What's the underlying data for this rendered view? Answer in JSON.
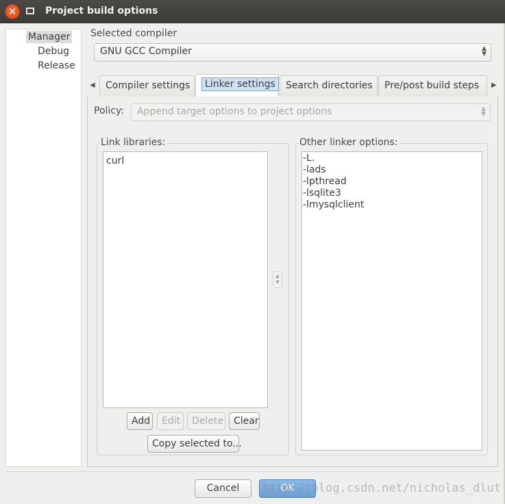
{
  "window": {
    "title": "Project build options",
    "close_glyph": "✕"
  },
  "tree": {
    "items": [
      {
        "label": "Manager"
      },
      {
        "label": "Debug"
      },
      {
        "label": "Release"
      }
    ]
  },
  "compiler": {
    "label": "Selected compiler",
    "value": "GNU GCC Compiler"
  },
  "tabs": [
    {
      "label": "Compiler settings"
    },
    {
      "label": "Linker settings"
    },
    {
      "label": "Search directories"
    },
    {
      "label": "Pre/post build steps"
    }
  ],
  "policy": {
    "label": "Policy:",
    "value": "Append target options to project options"
  },
  "link_libraries": {
    "label": "Link libraries:",
    "items": [
      "curl"
    ],
    "buttons": {
      "add": "Add",
      "edit": "Edit",
      "delete": "Delete",
      "clear": "Clear",
      "copy": "Copy selected to..."
    }
  },
  "other_linker_options": {
    "label": "Other linker options:",
    "lines": [
      "-L.",
      "-lads",
      "-lpthread",
      "-lsqlite3",
      "-lmysqlclient"
    ]
  },
  "footer": {
    "cancel": "Cancel",
    "ok": "OK"
  },
  "watermark": "http://blog.csdn.net/nicholas_dlut"
}
